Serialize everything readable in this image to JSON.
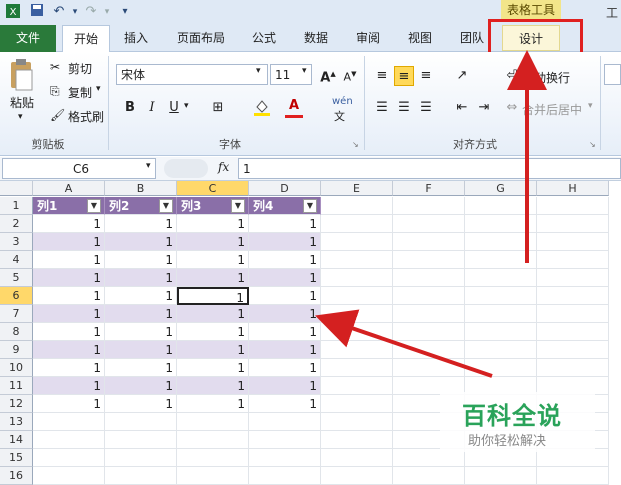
{
  "titlebar": {
    "contextual_tab": "表格工具",
    "title_fragment": "工"
  },
  "tabs": [
    "文件",
    "开始",
    "插入",
    "页面布局",
    "公式",
    "数据",
    "审阅",
    "视图",
    "团队",
    "设计"
  ],
  "clipboard": {
    "paste": "粘贴",
    "cut": "剪切",
    "copy": "复制",
    "format_painter": "格式刷",
    "group": "剪贴板"
  },
  "font": {
    "name": "宋体",
    "size": "11",
    "group": "字体",
    "bold": "B",
    "italic": "I",
    "underline": "U",
    "phonetic": "wén"
  },
  "alignment": {
    "wrap": "自动换行",
    "merge": "合并后居中",
    "group": "对齐方式"
  },
  "formula_bar": {
    "name_box": "C6",
    "fx": "fx",
    "value": "1"
  },
  "grid": {
    "columns": [
      "A",
      "B",
      "C",
      "D",
      "E",
      "F",
      "G",
      "H"
    ],
    "rows": [
      "1",
      "2",
      "3",
      "4",
      "5",
      "6",
      "7",
      "8",
      "9",
      "10",
      "11",
      "12",
      "13",
      "14",
      "15",
      "16"
    ],
    "headers": [
      "列1",
      "列2",
      "列3",
      "列4"
    ],
    "data": [
      [
        "1",
        "1",
        "1",
        "1"
      ],
      [
        "1",
        "1",
        "1",
        "1"
      ],
      [
        "1",
        "1",
        "1",
        "1"
      ],
      [
        "1",
        "1",
        "1",
        "1"
      ],
      [
        "1",
        "1",
        "1",
        "1"
      ],
      [
        "1",
        "1",
        "1",
        "1"
      ],
      [
        "1",
        "1",
        "1",
        "1"
      ],
      [
        "1",
        "1",
        "1",
        "1"
      ],
      [
        "1",
        "1",
        "1",
        "1"
      ],
      [
        "1",
        "1",
        "1",
        "1"
      ],
      [
        "1",
        "1",
        "1",
        "1"
      ]
    ]
  },
  "watermark": {
    "title": "百科全说",
    "subtitle": "助你轻松解决"
  },
  "colors": {
    "header_fill": "#8a6fa8",
    "band_fill": "#e2dcee",
    "arrow": "#d42020",
    "file_tab": "#2a7a3a"
  }
}
